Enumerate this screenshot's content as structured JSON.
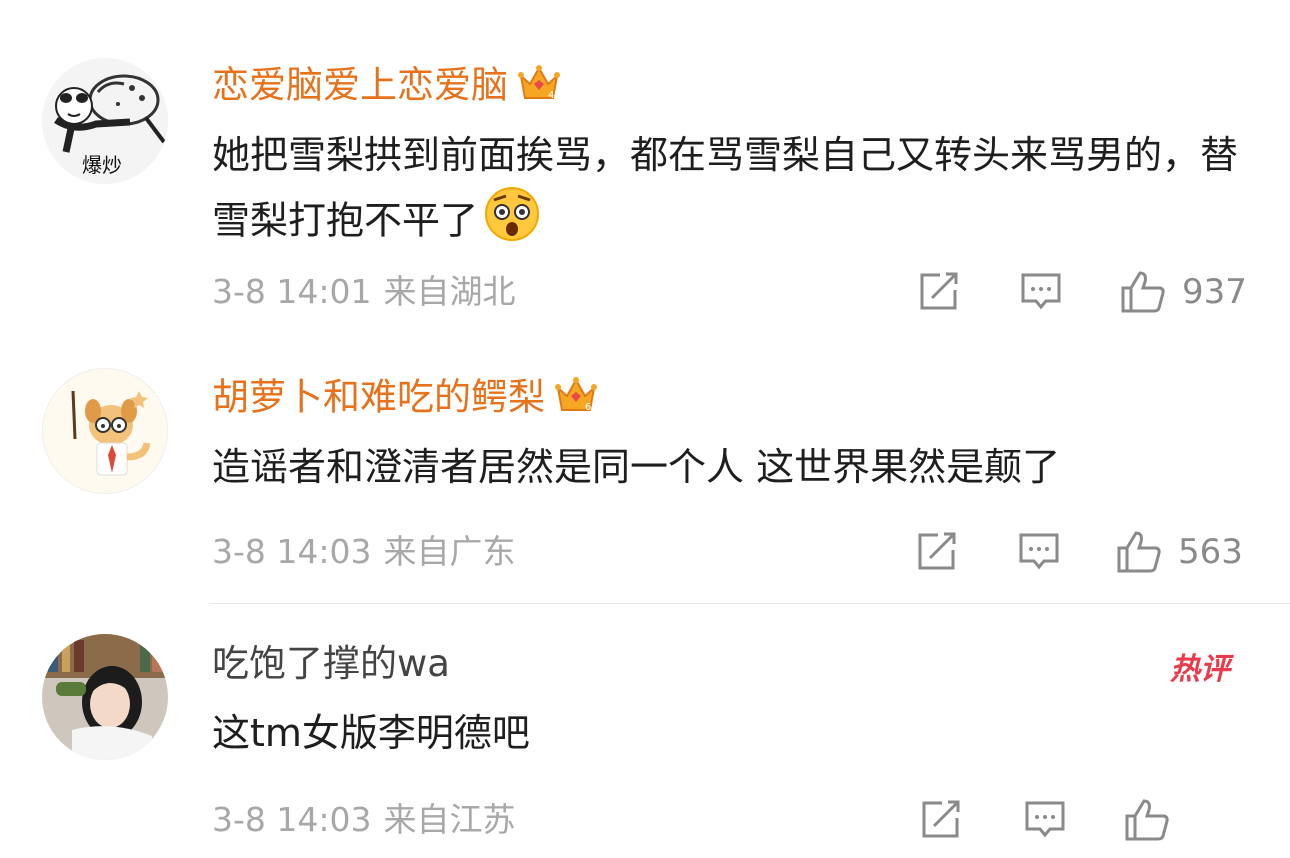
{
  "comments": [
    {
      "username": "恋爱脑爱上恋爱脑",
      "avatar_label": "爆炒",
      "text": "她把雪梨拱到前面挨骂，都在骂雪梨自己又转头来骂男的，替雪梨打抱不平了",
      "time": "3-8 14:01",
      "location": "来自湖北",
      "likes": "937"
    },
    {
      "username": "胡萝卜和难吃的鳄梨",
      "text": "造谣者和澄清者居然是同一个人 这世界果然是颠了",
      "time": "3-8 14:03",
      "location": "来自广东",
      "likes": "563"
    },
    {
      "username": "吃饱了撑的wa",
      "text": "这tm女版李明德吧",
      "time": "3-8 14:03",
      "location": "来自江苏",
      "badge": "热评"
    }
  ],
  "icons": {
    "vip": "crown-icon",
    "emoji": "shocked-face-icon",
    "share": "share-icon",
    "comment": "comment-icon",
    "like": "thumbs-up-icon"
  },
  "colors": {
    "vip_name": "#e8721c",
    "plain_name": "#444444",
    "meta": "#a8a8a8",
    "hot_badge": "#e83c4c"
  }
}
